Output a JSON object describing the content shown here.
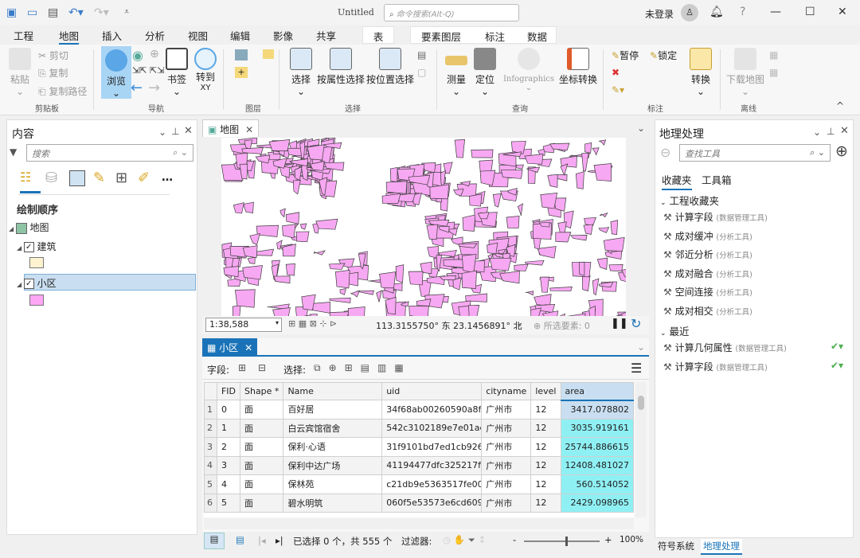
{
  "app": {
    "title": "Untitled",
    "command_search_placeholder": "命令搜索(Alt-Q)",
    "user": "未登录"
  },
  "menu_tabs": [
    "工程",
    "地图",
    "插入",
    "分析",
    "视图",
    "编辑",
    "影像",
    "共享"
  ],
  "context_tabs": [
    "表",
    "要素图层",
    "标注",
    "数据"
  ],
  "ribbon": {
    "clipboard": {
      "paste": "粘贴",
      "cut": "剪切",
      "copy": "复制",
      "copy_path": "复制路径",
      "label": "剪贴板"
    },
    "navigate": {
      "explore": "浏览",
      "bookmarks": "书签",
      "goto_xy": "转到",
      "goto_xy_sub": "XY",
      "label": "导航"
    },
    "layer": {
      "label": "图层"
    },
    "selection": {
      "select": "选择",
      "by_attr": "按属性选择",
      "by_loc": "按位置选择",
      "label": "选择"
    },
    "inquiry": {
      "measure": "测量",
      "locate": "定位",
      "infographics": "Infographics",
      "coord": "坐标转换",
      "label": "查询"
    },
    "labeling": {
      "pause": "暂停",
      "lock": "锁定",
      "convert": "转换",
      "label": "标注"
    },
    "offline": {
      "download": "下载地图",
      "label": "离线"
    }
  },
  "contents": {
    "title": "内容",
    "search_placeholder": "搜索",
    "draw_order": "绘制顺序",
    "map": "地图",
    "layers": [
      {
        "name": "建筑",
        "checked": true,
        "color": "#fdf3d0"
      },
      {
        "name": "小区",
        "checked": true,
        "color": "#fda6f5",
        "selected": true
      }
    ]
  },
  "map_view": {
    "tab": "地图",
    "scale": "1:38,588",
    "coords": "113.3155750° 东 23.1456891° 北",
    "selected_features": "所选要素: 0",
    "fill": "#f7a8f2",
    "stroke": "#3d3d3d"
  },
  "attr_table": {
    "tab": "小区",
    "fields_label": "字段:",
    "select_label": "选择:",
    "columns": [
      "FID",
      "Shape *",
      "Name",
      "uid",
      "cityname",
      "level",
      "area"
    ],
    "rows": [
      [
        "1",
        "0",
        "面",
        "百好居",
        "34f68ab00260590a8f5...",
        "广州市",
        "12",
        "3417.078802"
      ],
      [
        "2",
        "1",
        "面",
        "白云宾馆宿舍",
        "542c3102189e7e01ace...",
        "广州市",
        "12",
        "3035.919161"
      ],
      [
        "3",
        "2",
        "面",
        "保利·心语",
        "31f9101bd7ed1cb926e...",
        "广州市",
        "12",
        "25744.886615"
      ],
      [
        "4",
        "3",
        "面",
        "保利中达广场",
        "41194477dfc325217f29...",
        "广州市",
        "12",
        "12408.481027"
      ],
      [
        "5",
        "4",
        "面",
        "保林苑",
        "c21db9e5363517fe00ff...",
        "广州市",
        "12",
        "560.514052"
      ],
      [
        "6",
        "5",
        "面",
        "碧水明筑",
        "060f5e53573e6cd6091...",
        "广州市",
        "12",
        "2429.098965"
      ]
    ],
    "status": "已选择 0 个，共 555 个",
    "filter_label": "过滤器:",
    "zoom": "100%",
    "zoom_fraction": 0.55
  },
  "geoprocessing": {
    "title": "地理处理",
    "search_placeholder": "查找工具",
    "tabs": [
      "收藏夹",
      "工具箱"
    ],
    "project_favorites": "工程收藏夹",
    "favorites": [
      {
        "name": "计算字段",
        "toolbox": "(数据管理工具)"
      },
      {
        "name": "成对缓冲",
        "toolbox": "(分析工具)"
      },
      {
        "name": "邻近分析",
        "toolbox": "(分析工具)"
      },
      {
        "name": "成对融合",
        "toolbox": "(分析工具)"
      },
      {
        "name": "空间连接",
        "toolbox": "(分析工具)"
      },
      {
        "name": "成对相交",
        "toolbox": "(分析工具)"
      }
    ],
    "recent_label": "最近",
    "recent": [
      {
        "name": "计算几何属性",
        "toolbox": "(数据管理工具)",
        "status": "success"
      },
      {
        "name": "计算字段",
        "toolbox": "(数据管理工具)",
        "status": "success"
      }
    ]
  },
  "bottom_tabs": [
    "符号系统",
    "地理处理"
  ]
}
